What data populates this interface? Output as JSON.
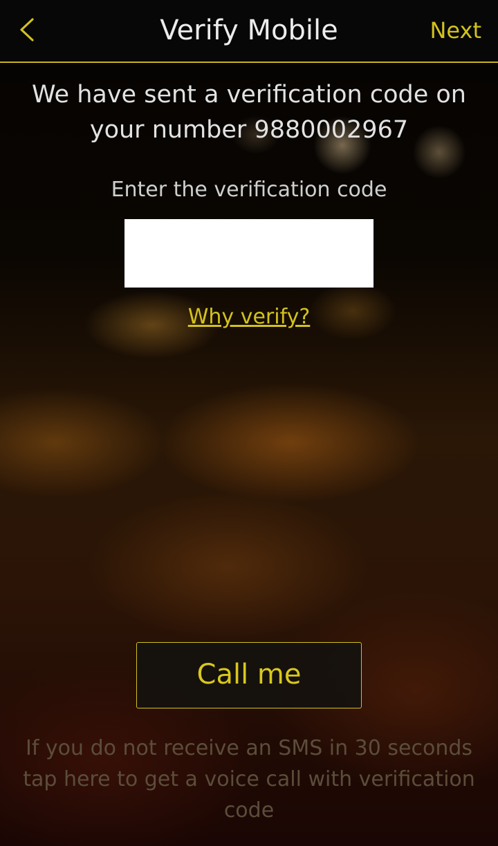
{
  "header": {
    "title": "Verify Mobile",
    "next_label": "Next",
    "back_icon": "chevron-left-icon",
    "accent_color": "#d2c21e"
  },
  "main": {
    "info_text": "We have sent a verification code on your number 9880002967",
    "prompt": "Enter the verification code",
    "code_input": {
      "value": "",
      "placeholder": ""
    },
    "why_link": "Why verify?",
    "call_button": "Call me",
    "help_text": "If you do not receive an SMS in 30 seconds tap here to get a voice call with verification code"
  }
}
